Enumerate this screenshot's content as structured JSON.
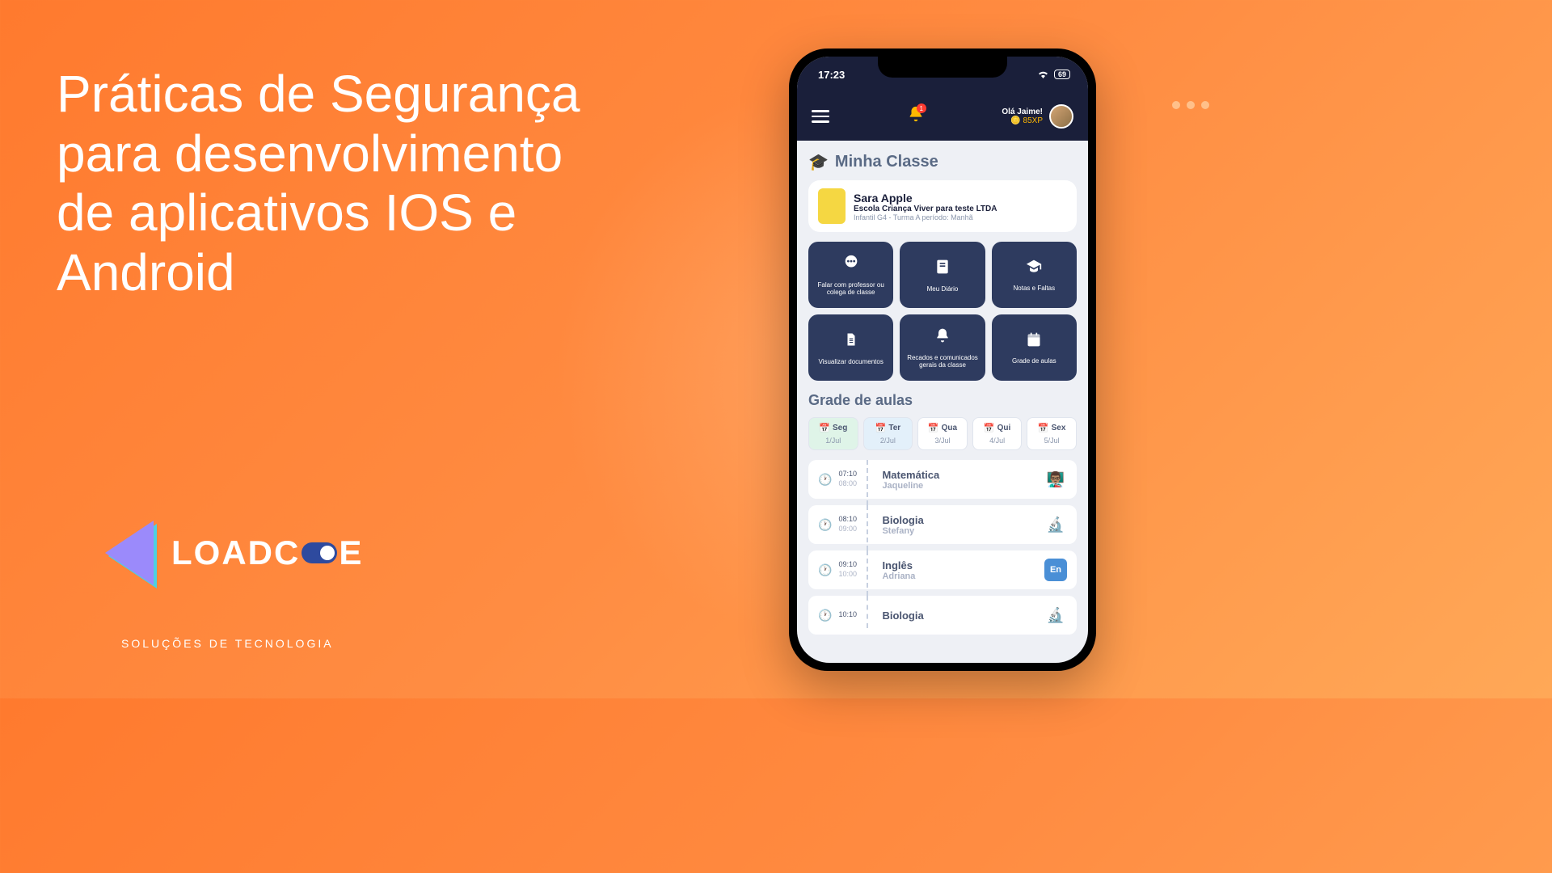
{
  "headline": "Práticas de Segurança para desenvolvimento de aplicativos IOS e Android",
  "logo": {
    "text_a": "LOADC",
    "text_b": "E",
    "subtitle": "SOLUÇÕES DE TECNOLOGIA"
  },
  "status": {
    "time": "17:23",
    "battery": "69"
  },
  "header": {
    "greeting": "Olá Jaime!",
    "xp": "85XP",
    "bell_count": "1"
  },
  "class_section": {
    "title": "Minha Classe",
    "student": {
      "name": "Sara Apple",
      "school": "Escola Criança Viver para teste LTDA",
      "class_info": "Infantil G4 - Turma A período: Manhã"
    },
    "tiles": [
      {
        "label": "Falar com professor ou colega de classe",
        "icon": "chat"
      },
      {
        "label": "Meu Diário",
        "icon": "diary"
      },
      {
        "label": "Notas e Faltas",
        "icon": "grad"
      },
      {
        "label": "Visualizar documentos",
        "icon": "doc"
      },
      {
        "label": "Recados e comunicados gerais da classe",
        "icon": "bell"
      },
      {
        "label": "Grade de aulas",
        "icon": "cal"
      }
    ]
  },
  "schedule": {
    "title": "Grade de aulas",
    "days": [
      {
        "name": "Seg",
        "date": "1/Jul",
        "state": "active"
      },
      {
        "name": "Ter",
        "date": "2/Jul",
        "state": "selected"
      },
      {
        "name": "Qua",
        "date": "3/Jul",
        "state": ""
      },
      {
        "name": "Qui",
        "date": "4/Jul",
        "state": ""
      },
      {
        "name": "Sex",
        "date": "5/Jul",
        "state": ""
      }
    ],
    "lessons": [
      {
        "start": "07:10",
        "end": "08:00",
        "subject": "Matemática",
        "teacher": "Jaqueline",
        "icon": "teacher"
      },
      {
        "start": "08:10",
        "end": "09:00",
        "subject": "Biologia",
        "teacher": "Stefany",
        "icon": "microscope"
      },
      {
        "start": "09:10",
        "end": "10:00",
        "subject": "Inglês",
        "teacher": "Adriana",
        "icon": "en"
      },
      {
        "start": "10:10",
        "end": "",
        "subject": "Biologia",
        "teacher": "",
        "icon": "microscope"
      }
    ]
  }
}
